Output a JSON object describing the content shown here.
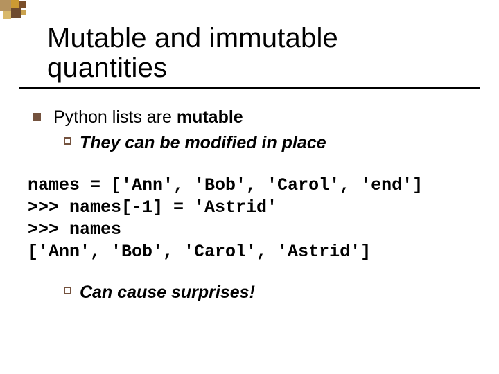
{
  "title": "Mutable and immutable quantities",
  "bullet1": "Python lists are ",
  "bullet1_bold": "mutable",
  "sub1": "They can be modified in place",
  "code": "names = ['Ann', 'Bob', 'Carol', 'end']\n>>> names[-1] = 'Astrid'\n>>> names\n['Ann', 'Bob', 'Carol', 'Astrid']",
  "sub2": "Can cause surprises!"
}
